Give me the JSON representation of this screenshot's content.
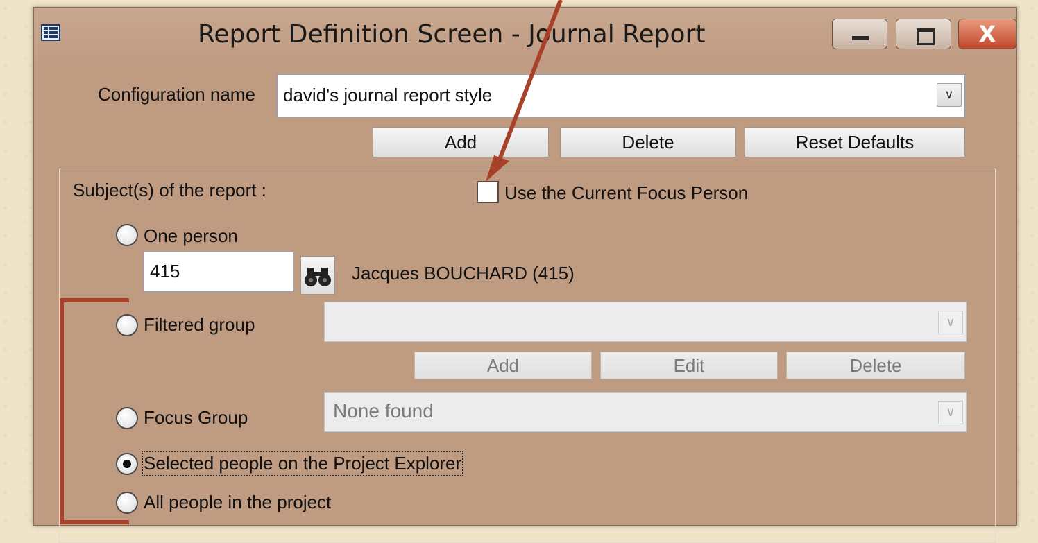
{
  "window": {
    "title": "Report Definition Screen - Journal Report",
    "controls": {
      "minimize": "minimize-icon",
      "maximize": "maximize-icon",
      "close": "X"
    }
  },
  "config": {
    "label": "Configuration name",
    "value": "david's journal report style",
    "buttons": {
      "add": "Add",
      "delete": "Delete",
      "reset": "Reset Defaults"
    }
  },
  "subject": {
    "label": "Subject(s) of the report :",
    "use_focus_label": "Use the Current Focus Person",
    "use_focus_checked": false,
    "options": {
      "one_person": "One person",
      "filtered_group": "Filtered group",
      "focus_group": "Focus Group",
      "selected_people": "Selected people on the Project Explorer",
      "all_people": "All people in the project"
    },
    "selected_option": "selected_people",
    "person_id": "415",
    "person_name": "Jacques BOUCHARD (415)",
    "filtered_group_value": "",
    "filter_buttons": {
      "add": "Add",
      "edit": "Edit",
      "delete": "Delete"
    },
    "focus_group_value": "None found"
  },
  "annotation": {
    "arrow_color": "#a8412a",
    "bracket_color": "#a8412a"
  }
}
